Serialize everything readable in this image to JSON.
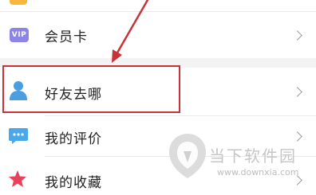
{
  "menu": {
    "items": [
      {
        "label": "会员卡",
        "icon": "vip-card-icon",
        "icon_text": "VIP"
      },
      {
        "label": "好友去哪",
        "icon": "person-icon"
      },
      {
        "label": "我的评价",
        "icon": "comment-icon"
      },
      {
        "label": "我的收藏",
        "icon": "star-icon"
      }
    ]
  },
  "watermark": {
    "brand": "当下软件园",
    "url": "www.downxia.com"
  },
  "colors": {
    "highlight": "#c8333a",
    "vip": "#8d84e8",
    "person": "#4a9fe0",
    "comment": "#4aa8ea",
    "star": "#e8415a"
  }
}
